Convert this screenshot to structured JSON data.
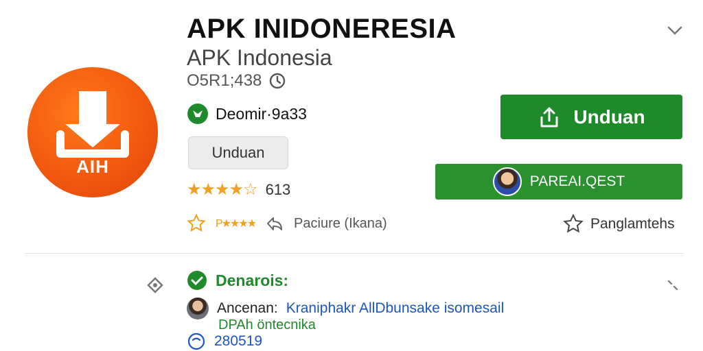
{
  "app": {
    "title": "APK INIDONERESIA",
    "subtitle": "APK Indonesia",
    "meta_text": "O5R1;438",
    "developer": "Deomir·9a33",
    "category_chip": "Unduan",
    "rating_count": "613",
    "icon_label": "AIH"
  },
  "buttons": {
    "primary": "Unduan",
    "secondary": "PAREAI.QEST"
  },
  "actions": {
    "share_label": "Paciure (Ikana)",
    "wishlist_label": "Panglamtehs"
  },
  "details": {
    "heading": "Denarois:",
    "author_prefix": "Ancenan:",
    "author_name": "Kraniphakr AllDbunsake isomesail",
    "green_line": "DPAh öntecnika",
    "number": "280519"
  },
  "colors": {
    "brand_orange": "#f15a0f",
    "primary_green": "#1f8a2a",
    "link_blue": "#1a55c0",
    "star": "#f0a020"
  },
  "icons": [
    "download-icon",
    "share-icon",
    "star-icon",
    "chevron-down-icon",
    "verified-icon",
    "check-circle-icon",
    "tag-icon",
    "resize-icon",
    "timer-icon"
  ]
}
